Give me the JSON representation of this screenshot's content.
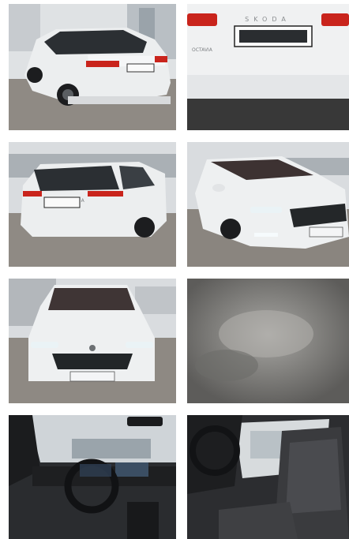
{
  "gallery": {
    "photos": [
      {
        "name": "rear-three-quarter-left"
      },
      {
        "name": "rear-close-up",
        "badge": "SKODA",
        "model_badge": "OCTAVIA"
      },
      {
        "name": "rear-view",
        "badge": "SKODA"
      },
      {
        "name": "front-three-quarter"
      },
      {
        "name": "front-view"
      },
      {
        "name": "blurred-photo"
      },
      {
        "name": "dashboard-interior"
      },
      {
        "name": "front-seats-interior"
      }
    ]
  },
  "colors": {
    "car_body": "#eceeef",
    "sky": "#d9dcdf",
    "ground": "#8f8a84",
    "taillight": "#c9241c",
    "grille": "#222628",
    "interior": "#2a2c2f"
  }
}
